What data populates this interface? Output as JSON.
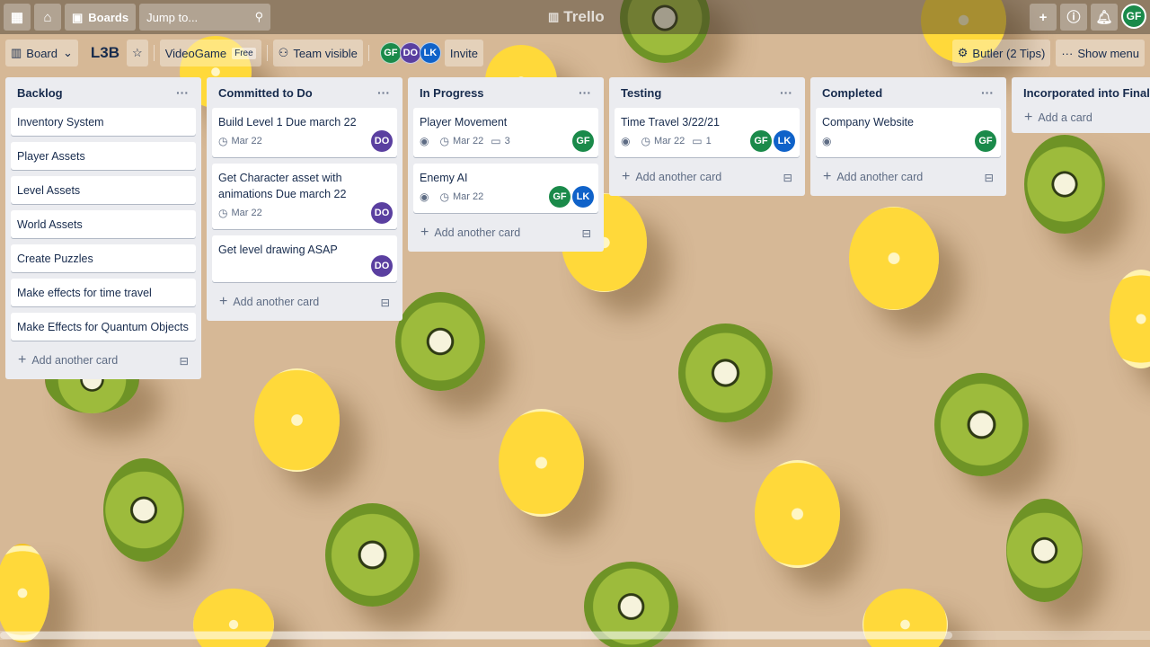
{
  "header": {
    "boards_label": "Boards",
    "search_placeholder": "Jump to...",
    "app_name": "Trello",
    "user_avatar": "GF"
  },
  "board_bar": {
    "view_label": "Board",
    "title": "L3B",
    "workspace_label": "VideoGame",
    "free_badge": "Free",
    "visibility_label": "Team visible",
    "members": [
      "GF",
      "DO",
      "LK"
    ],
    "invite_label": "Invite",
    "butler_label": "Butler (2 Tips)",
    "show_menu_label": "Show menu"
  },
  "colors": {
    "GF": "#1a8a4a",
    "DO": "#5a3fa0",
    "LK": "#0f62c9"
  },
  "lists": [
    {
      "title": "Backlog",
      "cards": [
        {
          "title": "Inventory System"
        },
        {
          "title": "Player Assets"
        },
        {
          "title": "Level Assets"
        },
        {
          "title": "World Assets"
        },
        {
          "title": "Create Puzzles"
        },
        {
          "title": "Make effects for time travel"
        },
        {
          "title": "Make Effects for Quantum Objects"
        }
      ],
      "add_label": "Add another card"
    },
    {
      "title": "Committed to Do",
      "cards": [
        {
          "title": "Build Level 1 Due march 22",
          "due": "Mar 22",
          "members": [
            "DO"
          ]
        },
        {
          "title": "Get Character asset with animations Due march 22",
          "due": "Mar 22",
          "members": [
            "DO"
          ]
        },
        {
          "title": "Get level drawing ASAP",
          "members": [
            "DO"
          ]
        }
      ],
      "add_label": "Add another card"
    },
    {
      "title": "In Progress",
      "cards": [
        {
          "title": "Player Movement",
          "watch": true,
          "due": "Mar 22",
          "comments": "3",
          "members": [
            "GF"
          ]
        },
        {
          "title": "Enemy AI",
          "watch": true,
          "due": "Mar 22",
          "members": [
            "GF",
            "LK"
          ]
        }
      ],
      "add_label": "Add another card"
    },
    {
      "title": "Testing",
      "cards": [
        {
          "title": "Time Travel 3/22/21",
          "watch": true,
          "due": "Mar 22",
          "comments": "1",
          "members": [
            "GF",
            "LK"
          ]
        }
      ],
      "add_label": "Add another card"
    },
    {
      "title": "Completed",
      "cards": [
        {
          "title": "Company Website",
          "watch": true,
          "members": [
            "GF"
          ]
        }
      ],
      "add_label": "Add another card"
    },
    {
      "title": "Incorporated into Final Game",
      "cards": [],
      "add_label": "Add a card"
    }
  ]
}
